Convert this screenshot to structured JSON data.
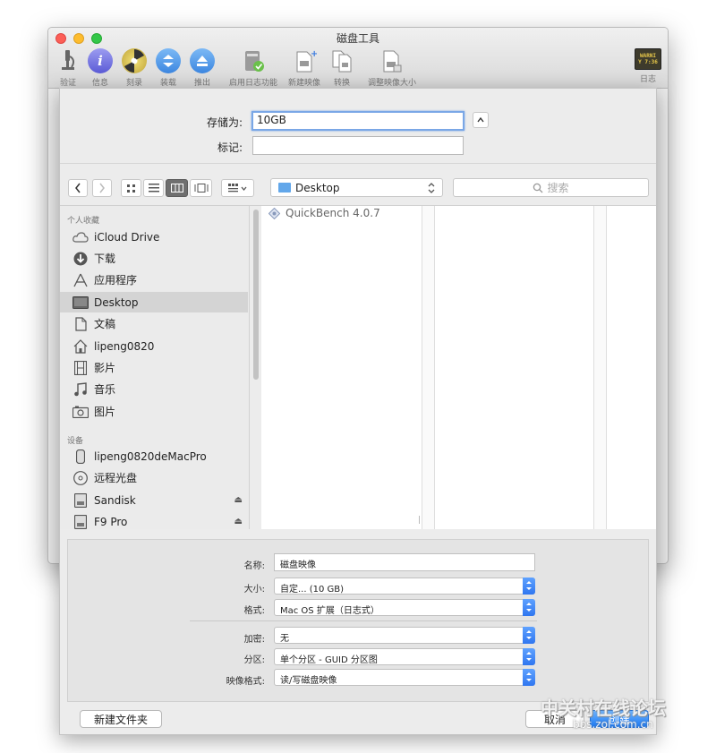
{
  "window": {
    "title": "磁盘工具",
    "toolbar": [
      {
        "label": "验证",
        "icon": "microscope-icon"
      },
      {
        "label": "信息",
        "icon": "info-icon"
      },
      {
        "label": "刻录",
        "icon": "burn-icon"
      },
      {
        "label": "装载",
        "icon": "mount-icon"
      },
      {
        "label": "推出",
        "icon": "eject-icon"
      },
      {
        "label": "启用日志功能",
        "icon": "journal-icon"
      },
      {
        "label": "新建映像",
        "icon": "new-image-icon"
      },
      {
        "label": "转换",
        "icon": "convert-icon"
      },
      {
        "label": "调整映像大小",
        "icon": "resize-image-icon"
      },
      {
        "label": "日志",
        "icon": "log-icon"
      }
    ],
    "log_icon_text": [
      "WARNI",
      "Y 7:36"
    ]
  },
  "save": {
    "save_as_label": "存储为:",
    "save_as_value": "10GB",
    "tags_label": "标记:",
    "tags_value": "",
    "expand_icon": "chevron-up-icon"
  },
  "browser": {
    "location": "Desktop",
    "search_placeholder": "搜索",
    "view_modes": [
      "icon-view",
      "list-view",
      "column-view",
      "coverflow-view"
    ],
    "sidebar_sections": [
      {
        "title": "个人收藏",
        "items": [
          {
            "label": "iCloud Drive",
            "icon": "cloud-icon"
          },
          {
            "label": "下载",
            "icon": "download-icon"
          },
          {
            "label": "应用程序",
            "icon": "applications-icon"
          },
          {
            "label": "Desktop",
            "icon": "desktop-icon",
            "selected": true
          },
          {
            "label": "文稿",
            "icon": "documents-icon"
          },
          {
            "label": "lipeng0820",
            "icon": "home-icon"
          },
          {
            "label": "影片",
            "icon": "movies-icon"
          },
          {
            "label": "音乐",
            "icon": "music-icon"
          },
          {
            "label": "图片",
            "icon": "pictures-icon"
          }
        ]
      },
      {
        "title": "设备",
        "items": [
          {
            "label": "lipeng0820deMacPro",
            "icon": "computer-icon"
          },
          {
            "label": "远程光盘",
            "icon": "remote-disc-icon"
          },
          {
            "label": "Sandisk",
            "icon": "drive-icon",
            "eject": true
          },
          {
            "label": "F9 Pro",
            "icon": "drive-icon",
            "eject": true
          }
        ]
      }
    ],
    "files": [
      {
        "name": "QuickBench 4.0.7",
        "icon": "app-icon"
      }
    ]
  },
  "options": {
    "name_label": "名称:",
    "name_value": "磁盘映像",
    "size_label": "大小:",
    "size_value": "自定... (10 GB)",
    "format_label": "格式:",
    "format_value": "Mac OS 扩展（日志式）",
    "encryption_label": "加密:",
    "encryption_value": "无",
    "partitions_label": "分区:",
    "partitions_value": "单个分区 - GUID 分区图",
    "image_format_label": "映像格式:",
    "image_format_value": "读/写磁盘映像"
  },
  "buttons": {
    "new_folder": "新建文件夹",
    "cancel": "取消",
    "create": "创建"
  },
  "watermark": {
    "line1": "中关村在线论坛",
    "line2": "bbs.zol.com.cn"
  },
  "colors": {
    "accent": "#2f76f0",
    "selection": "#d4d4d4"
  }
}
